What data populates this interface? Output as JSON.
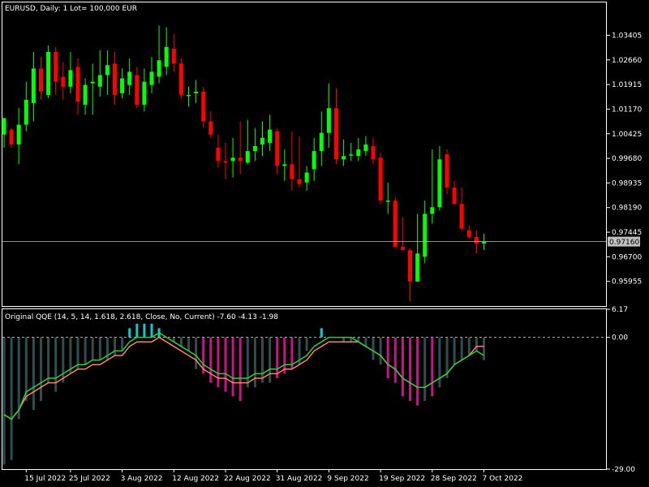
{
  "window": {
    "symbol_line": "EURUSD, Daily:  1 Lot= 100,000 EUR"
  },
  "indicator": {
    "title_line": "Original QQE (14, 5, 14, 1.618, 2.618, Close, No, Current) -7.60 -4.13 -1.98"
  },
  "colors": {
    "background": "#000000",
    "frame": "#ffffff",
    "bull": "#00ff00",
    "bear": "#ff0000",
    "hist_gray": "#2f4f4f",
    "hist_magenta": "#c71585",
    "hist_cyan": "#00ced1",
    "rsi_line": "#32cd32",
    "trail_line": "#fa8072",
    "price_line": "#c0c0c0",
    "price_tag_bg": "#c0c0c0",
    "price_tag_text": "#000000"
  },
  "chart_data": [
    {
      "type": "candlestick",
      "title": "EURUSD, Daily:  1 Lot= 100,000 EUR",
      "x": [
        "2022-07-12",
        "2022-07-13",
        "2022-07-14",
        "2022-07-15",
        "2022-07-18",
        "2022-07-19",
        "2022-07-20",
        "2022-07-21",
        "2022-07-22",
        "2022-07-25",
        "2022-07-26",
        "2022-07-27",
        "2022-07-28",
        "2022-07-29",
        "2022-08-01",
        "2022-08-02",
        "2022-08-03",
        "2022-08-04",
        "2022-08-05",
        "2022-08-08",
        "2022-08-09",
        "2022-08-10",
        "2022-08-11",
        "2022-08-12",
        "2022-08-15",
        "2022-08-16",
        "2022-08-17",
        "2022-08-18",
        "2022-08-19",
        "2022-08-22",
        "2022-08-23",
        "2022-08-24",
        "2022-08-25",
        "2022-08-26",
        "2022-08-29",
        "2022-08-30",
        "2022-08-31",
        "2022-09-01",
        "2022-09-02",
        "2022-09-05",
        "2022-09-06",
        "2022-09-07",
        "2022-09-08",
        "2022-09-09",
        "2022-09-12",
        "2022-09-13",
        "2022-09-14",
        "2022-09-15",
        "2022-09-16",
        "2022-09-19",
        "2022-09-20",
        "2022-09-21",
        "2022-09-22",
        "2022-09-23",
        "2022-09-26",
        "2022-09-27",
        "2022-09-28",
        "2022-09-29",
        "2022-09-30",
        "2022-10-03",
        "2022-10-04",
        "2022-10-05",
        "2022-10-06",
        "2022-10-07",
        "2022-10-10",
        "2022-10-11"
      ],
      "open": [
        1.004,
        1.0055,
        1.001,
        1.007,
        1.0135,
        1.024,
        1.016,
        1.029,
        1.0215,
        1.0185,
        1.0245,
        1.013,
        1.0195,
        1.0185,
        1.022,
        1.0255,
        1.0165,
        1.019,
        1.022,
        1.013,
        1.019,
        1.0215,
        1.0245,
        1.03,
        1.0255,
        1.016,
        1.0165,
        1.017,
        1.008,
        1.0,
        0.996,
        0.996,
        0.997,
        0.9955,
        0.999,
        1.001,
        1.0015,
        1.005,
        0.9945,
        0.995,
        0.9905,
        0.9895,
        0.9935,
        0.999,
        1.0045,
        1.012,
        0.9965,
        0.998,
        0.9975,
        0.999,
        1.0005,
        0.997,
        0.984,
        0.984,
        0.97,
        0.969,
        0.9595,
        0.967,
        0.98,
        0.982,
        0.998,
        0.988,
        0.983,
        0.975,
        0.973,
        0.971
      ],
      "close": [
        1.009,
        1.001,
        1.007,
        1.0145,
        1.024,
        1.017,
        1.029,
        1.02,
        1.0185,
        1.0235,
        1.014,
        1.019,
        1.02,
        1.022,
        1.025,
        1.016,
        1.021,
        1.023,
        1.013,
        1.02,
        1.023,
        1.0265,
        1.0305,
        1.0255,
        1.016,
        1.016,
        1.017,
        1.008,
        1.004,
        0.996,
        0.9955,
        0.997,
        0.996,
        0.999,
        1.0005,
        1.003,
        1.0055,
        0.9945,
        0.995,
        0.9905,
        0.989,
        0.9925,
        0.999,
        1.0045,
        1.012,
        0.9965,
        0.9975,
        0.998,
        0.9995,
        1.001,
        0.9965,
        0.984,
        0.984,
        0.97,
        0.969,
        0.9595,
        0.968,
        0.98,
        0.982,
        0.9965,
        0.988,
        0.983,
        0.9755,
        0.973,
        0.971,
        0.9716
      ],
      "high": [
        1.006,
        1.006,
        1.012,
        1.02,
        1.029,
        1.0275,
        1.031,
        1.0305,
        1.026,
        1.029,
        1.027,
        1.021,
        1.0255,
        1.0295,
        1.0295,
        1.029,
        1.024,
        1.027,
        1.0245,
        1.024,
        1.0275,
        1.037,
        1.0365,
        1.0345,
        1.027,
        1.0185,
        1.0205,
        1.0185,
        1.011,
        1.004,
        1.0015,
        1.003,
        1.008,
        1.0085,
        1.006,
        1.008,
        1.01,
        1.006,
        0.9995,
        1.005,
        1.0035,
        0.9945,
        1.003,
        1.011,
        1.0195,
        1.018,
        1.0025,
        1.0015,
        1.003,
        1.0035,
        1.003,
        0.9985,
        0.9895,
        0.985,
        0.979,
        0.9695,
        0.98,
        0.984,
        0.9995,
        1.0005,
        0.9995,
        0.99,
        0.988,
        0.9765,
        0.975,
        0.974
      ],
      "low": [
        1.0,
        1.0,
        0.995,
        1.005,
        1.008,
        1.0145,
        1.015,
        1.016,
        1.0145,
        1.0165,
        1.01,
        1.01,
        1.01,
        1.0155,
        1.016,
        1.013,
        1.015,
        1.016,
        1.012,
        1.011,
        1.0165,
        1.0195,
        1.022,
        1.023,
        1.015,
        1.0125,
        1.0135,
        1.006,
        1.003,
        0.994,
        0.9905,
        0.991,
        0.992,
        0.995,
        0.996,
        0.9975,
        0.999,
        0.992,
        0.99,
        0.987,
        0.988,
        0.987,
        0.99,
        0.9945,
        1.0,
        0.995,
        0.9945,
        0.996,
        0.996,
        0.9975,
        0.995,
        0.983,
        0.98,
        0.978,
        0.969,
        0.9535,
        0.9595,
        0.965,
        0.977,
        0.981,
        0.986,
        0.983,
        0.975,
        0.9725,
        0.968,
        0.969
      ],
      "ylim": [
        0.9521,
        1.044
      ],
      "y_ticks": [
        "1.03405",
        "1.02660",
        "1.01915",
        "1.01170",
        "1.00425",
        "0.99680",
        "0.98935",
        "0.98190",
        "0.97445",
        "0.96700",
        "0.95955"
      ],
      "current_price": "0.97160",
      "x_tick_labels": [
        "15 Jul 2022",
        "25 Jul 2022",
        "3 Aug 2022",
        "12 Aug 2022",
        "22 Aug 2022",
        "31 Aug 2022",
        "9 Sep 2022",
        "19 Sep 2022",
        "28 Sep 2022",
        "7 Oct 2022"
      ],
      "grid": false
    },
    {
      "type": "histogram-with-lines",
      "title": "Original QQE (14, 5, 14, 1.618, 2.618, Close, No, Current) -7.60 -4.13 -1.98",
      "histogram": [
        -28,
        -27,
        -18,
        -14,
        -16,
        -14,
        -10,
        -12,
        -10,
        -8,
        -7,
        -6,
        -5,
        -5,
        -5,
        -4,
        -3,
        2,
        3,
        3,
        3,
        2,
        0,
        -1,
        -2,
        -3,
        -7,
        -8,
        -10,
        -11,
        -12,
        -13,
        -14,
        -11,
        -11,
        -10,
        -10,
        -9,
        -8,
        -7,
        -6,
        -3,
        0,
        2,
        0,
        0,
        -1,
        -1,
        -1,
        -2,
        -5,
        -6,
        -9,
        -10,
        -13,
        -14,
        -15,
        -14,
        -13,
        -11,
        -9,
        -6,
        -5,
        -4,
        -3,
        -5
      ],
      "series": [
        {
          "values": [
            -17,
            -18,
            -16,
            -12,
            -11,
            -10,
            -9,
            -9,
            -8,
            -7,
            -6,
            -6,
            -5,
            -5,
            -4,
            -3,
            -3,
            -1,
            0,
            0,
            0,
            1,
            0,
            -1,
            -2,
            -3,
            -4,
            -6,
            -7,
            -8,
            -8,
            -9,
            -9,
            -9,
            -8,
            -8,
            -7,
            -7,
            -6,
            -6,
            -5,
            -4,
            -2,
            -1,
            0,
            0,
            0,
            0,
            -1,
            -2,
            -3,
            -4,
            -6,
            -7,
            -9,
            -10,
            -11,
            -11,
            -10,
            -9,
            -8,
            -6,
            -5,
            -4,
            -3,
            -4
          ]
        },
        {
          "values": [
            -17,
            -18,
            -16,
            -13,
            -12,
            -11,
            -10,
            -10,
            -9,
            -8,
            -7,
            -7,
            -6,
            -6,
            -5,
            -4,
            -4,
            -2,
            -1,
            -1,
            -1,
            0,
            -1,
            -2,
            -3,
            -4,
            -5,
            -7,
            -8,
            -9,
            -9,
            -10,
            -10,
            -10,
            -9,
            -9,
            -8,
            -8,
            -7,
            -7,
            -6,
            -5,
            -3,
            -2,
            -1,
            -1,
            -1,
            -1,
            -1,
            -2,
            -3,
            -4,
            -6,
            -7,
            -9,
            -10,
            -11,
            -11,
            -10,
            -9,
            -8,
            -6,
            -5,
            -4,
            -2,
            -2
          ]
        }
      ],
      "ylim": [
        -29,
        6.17
      ],
      "y_ticks": [
        "6.17",
        "0.00",
        "-29.00"
      ],
      "zero_line": "dashed"
    }
  ]
}
